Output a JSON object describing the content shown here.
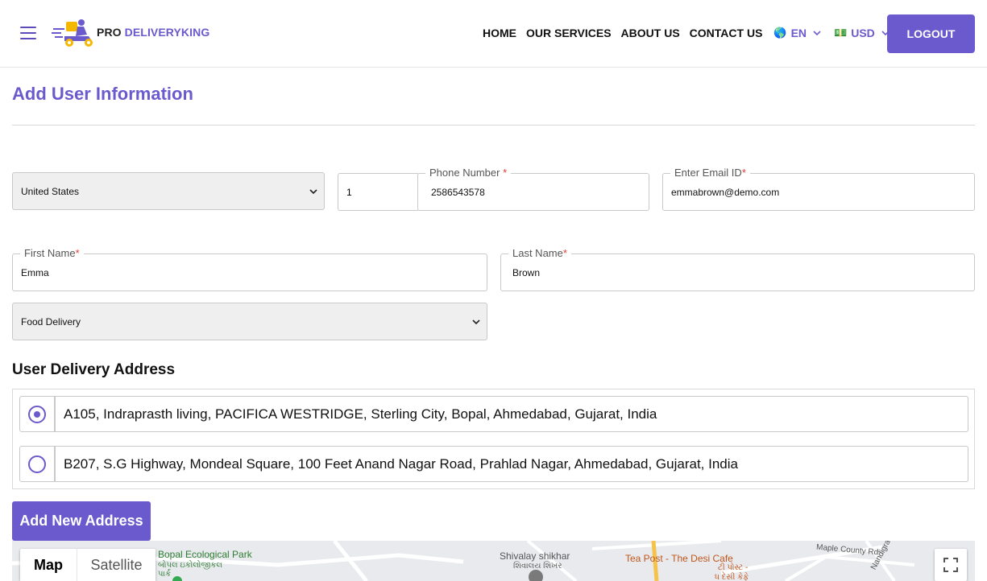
{
  "header": {
    "logo_prefix": "PRO",
    "logo_name": "DELIVERYKING",
    "nav": [
      "HOME",
      "OUR SERVICES",
      "ABOUT US",
      "CONTACT US"
    ],
    "language": {
      "flag": "🌎",
      "code": "EN"
    },
    "currency": {
      "flag": "💵",
      "code": "USD"
    },
    "logout_label": "LOGOUT"
  },
  "page": {
    "title": "Add User Information"
  },
  "form": {
    "country_select": "United States",
    "phone_code": "1",
    "phone_label": "Phone Number",
    "phone_value": "2586543578",
    "email_label": "Enter Email ID",
    "email_value": "emmabrown@demo.com",
    "first_name_label": "First Name",
    "first_name_value": "Emma",
    "last_name_label": "Last Name",
    "last_name_value": "Brown",
    "service_select": "Food Delivery",
    "required_mark": "*"
  },
  "address_section": {
    "heading": "User Delivery Address",
    "addresses": [
      {
        "text": "A105, Indraprasth living, PACIFICA WESTRIDGE, Sterling City, Bopal, Ahmedabad, Gujarat, India",
        "selected": true
      },
      {
        "text": "B207, S.G Highway, Mondeal Square, 100 Feet Anand Nagar Road, Prahlad Nagar, Ahmedabad, Gujarat, India",
        "selected": false
      }
    ],
    "add_button": "Add New Address"
  },
  "map": {
    "map_label": "Map",
    "satellite_label": "Satellite",
    "places": {
      "park": "Bopal Ecological Park",
      "park_local": "બોપલ ઇકોલોજીકલ",
      "park_local_2": "પાર્ક",
      "shikhar": "Shivalay shikhar",
      "shikhar_local": "શિવાલય શિખર",
      "cafe": "Tea Post - The Desi Cafe",
      "cafe_local": "ટી પોસ્ટ -",
      "cafe_local_2": "ધ દેસી કેફે",
      "road1": "Maple County Rd",
      "road2": "Nandigra"
    }
  },
  "colors": {
    "brand": "#6a5acd",
    "required": "#e53935"
  }
}
